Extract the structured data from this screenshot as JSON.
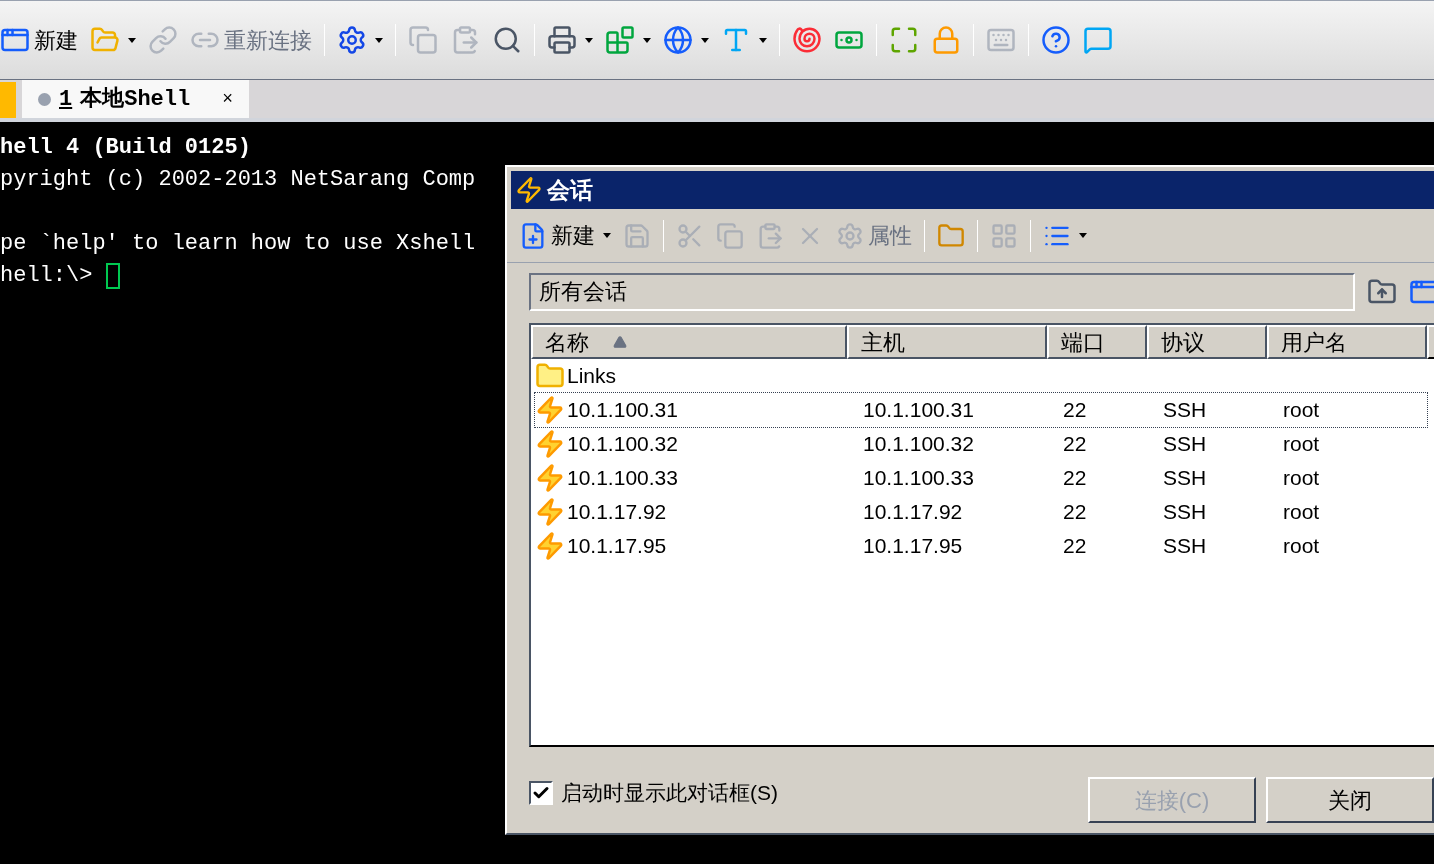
{
  "toolbar": [
    {
      "kind": "button",
      "label": "新建",
      "disabled": false,
      "dropdown": false
    },
    {
      "kind": "button",
      "disabled": false,
      "dropdown": true
    },
    {
      "kind": "button",
      "disabled": true,
      "dropdown": false
    },
    {
      "kind": "button",
      "label": "重新连接",
      "disabled": true,
      "dropdown": false
    },
    {
      "kind": "separator"
    },
    {
      "kind": "button",
      "disabled": false,
      "dropdown": true
    },
    {
      "kind": "separator"
    },
    {
      "kind": "button",
      "disabled": true,
      "dropdown": false
    },
    {
      "kind": "button",
      "disabled": true,
      "dropdown": false
    },
    {
      "kind": "button",
      "disabled": false,
      "dropdown": false
    },
    {
      "kind": "separator"
    },
    {
      "kind": "button",
      "disabled": false,
      "dropdown": true
    },
    {
      "kind": "button",
      "disabled": false,
      "dropdown": true
    },
    {
      "kind": "button",
      "disabled": false,
      "dropdown": true
    },
    {
      "kind": "button",
      "disabled": false,
      "dropdown": true
    },
    {
      "kind": "separator"
    },
    {
      "kind": "button",
      "disabled": false,
      "dropdown": false
    },
    {
      "kind": "button",
      "disabled": false,
      "dropdown": false
    },
    {
      "kind": "separator"
    },
    {
      "kind": "button",
      "disabled": false,
      "dropdown": false
    },
    {
      "kind": "button",
      "disabled": false,
      "dropdown": false
    },
    {
      "kind": "separator"
    },
    {
      "kind": "button",
      "disabled": true,
      "dropdown": false
    },
    {
      "kind": "separator"
    },
    {
      "kind": "button",
      "disabled": false,
      "dropdown": false
    },
    {
      "kind": "button",
      "disabled": false,
      "dropdown": false
    }
  ],
  "tabs": [
    {
      "number": "1",
      "label": "本地Shell",
      "close": "×",
      "selected": true
    }
  ],
  "terminal": {
    "lines": [
      {
        "kind": "text",
        "text": "hell 4 (Build 0125)",
        "bold": true
      },
      {
        "kind": "text",
        "text": "pyright (c) 2002-2013 NetSarang Comp",
        "bold": false
      },
      {
        "kind": "blank"
      },
      {
        "kind": "text",
        "text": "pe `help' to learn how to use Xshell",
        "bold": false
      },
      {
        "kind": "text",
        "text": "hell:\\>",
        "bold": false,
        "cursor": true
      }
    ]
  },
  "dialog": {
    "title": "会话",
    "toolbar": [
      {
        "kind": "button",
        "label": "新建",
        "disabled": false,
        "dropdown": true
      },
      {
        "kind": "button",
        "disabled": true,
        "dropdown": false
      },
      {
        "kind": "separator"
      },
      {
        "kind": "button",
        "disabled": true,
        "dropdown": false
      },
      {
        "kind": "button",
        "disabled": true,
        "dropdown": false
      },
      {
        "kind": "button",
        "disabled": true,
        "dropdown": false
      },
      {
        "kind": "button",
        "disabled": true,
        "dropdown": false
      },
      {
        "kind": "button",
        "label": "属性",
        "disabled": true,
        "dropdown": false
      },
      {
        "kind": "separator"
      },
      {
        "kind": "button",
        "disabled": false,
        "dropdown": false
      },
      {
        "kind": "separator"
      },
      {
        "kind": "button",
        "disabled": true,
        "dropdown": false
      },
      {
        "kind": "separator"
      },
      {
        "kind": "button",
        "disabled": false,
        "dropdown": true
      }
    ],
    "path": {
      "value": "所有会话"
    },
    "table": {
      "columns": [
        {
          "label": "名称",
          "sorted": true
        },
        {
          "label": "主机",
          "sorted": false
        },
        {
          "label": "端口",
          "sorted": false
        },
        {
          "label": "协议",
          "sorted": false
        },
        {
          "label": "用户名",
          "sorted": false
        }
      ],
      "rows": [
        {
          "kind": "folder",
          "cells": [
            "Links"
          ],
          "focused": false
        },
        {
          "kind": "session",
          "cells": [
            "10.1.100.31",
            "10.1.100.31",
            "22",
            "SSH",
            "root"
          ],
          "focused": true
        },
        {
          "kind": "session",
          "cells": [
            "10.1.100.32",
            "10.1.100.32",
            "22",
            "SSH",
            "root"
          ],
          "focused": false
        },
        {
          "kind": "session",
          "cells": [
            "10.1.100.33",
            "10.1.100.33",
            "22",
            "SSH",
            "root"
          ],
          "focused": false
        },
        {
          "kind": "session",
          "cells": [
            "10.1.17.92",
            "10.1.17.92",
            "22",
            "SSH",
            "root"
          ],
          "focused": false
        },
        {
          "kind": "session",
          "cells": [
            "10.1.17.95",
            "10.1.17.95",
            "22",
            "SSH",
            "root"
          ],
          "focused": false
        }
      ]
    },
    "show_on_startup": {
      "label": "启动时显示此对话框(S)",
      "checked": true
    },
    "buttons": [
      {
        "label": "连接(C)",
        "disabled": true
      },
      {
        "label": "关闭",
        "disabled": false
      }
    ]
  }
}
